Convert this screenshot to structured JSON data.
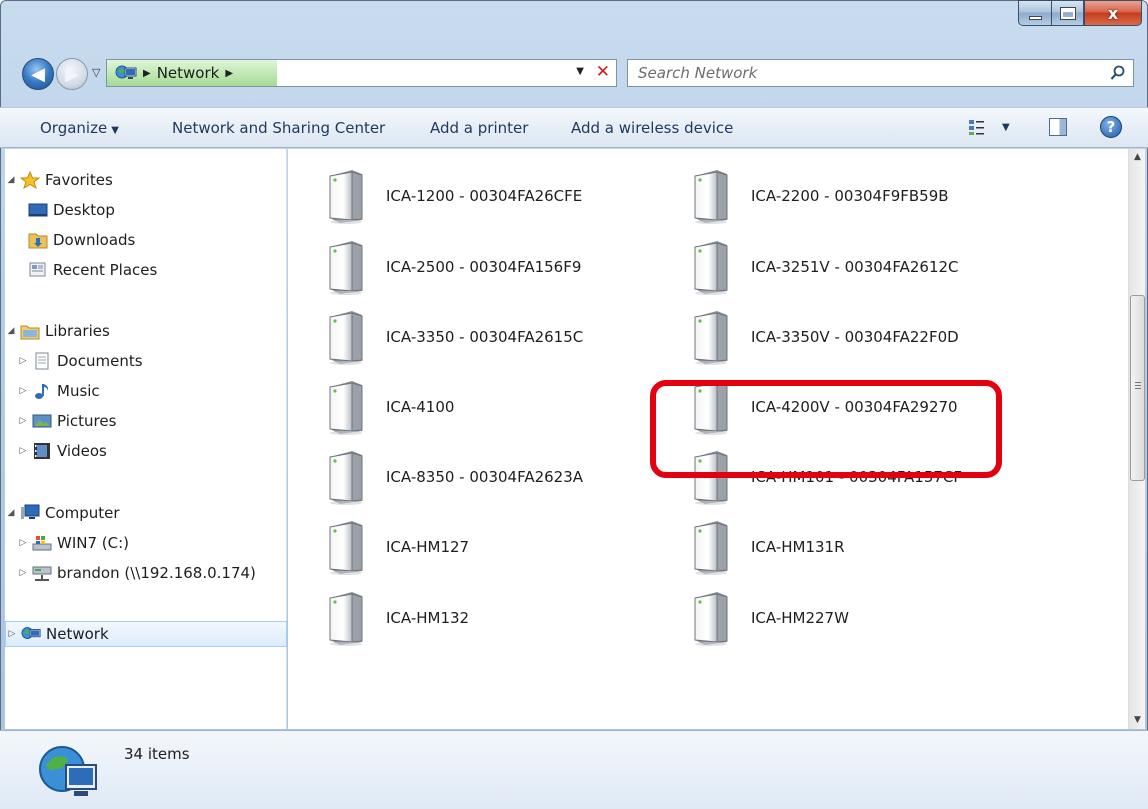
{
  "window": {
    "caption_close": "x"
  },
  "address_bar": {
    "location": "Network",
    "search_placeholder": "Search Network"
  },
  "toolbar": {
    "organize": "Organize",
    "network_sharing": "Network and Sharing Center",
    "add_printer": "Add a printer",
    "add_wireless": "Add a wireless device"
  },
  "nav": {
    "favorites": "Favorites",
    "desktop": "Desktop",
    "downloads": "Downloads",
    "recent_places": "Recent Places",
    "libraries": "Libraries",
    "documents": "Documents",
    "music": "Music",
    "pictures": "Pictures",
    "videos": "Videos",
    "computer": "Computer",
    "win7": "WIN7 (C:)",
    "brandon": "brandon (\\\\192.168.0.174)",
    "network": "Network"
  },
  "items": [
    "ICA-1200 - 00304FA26CFE",
    "ICA-2200 - 00304F9FB59B",
    "ICA-2500 - 00304FA156F9",
    "ICA-3251V - 00304FA2612C",
    "ICA-3350 - 00304FA2615C",
    "ICA-3350V - 00304FA22F0D",
    "ICA-4100",
    "ICA-4200V - 00304FA29270",
    "ICA-8350 - 00304FA2623A",
    "ICA-HM101 - 00304FA157CF",
    "ICA-HM127",
    "ICA-HM131R",
    "ICA-HM132",
    "ICA-HM227W"
  ],
  "highlighted_item": "ICA-4200V - 00304FA29270",
  "status": {
    "count": "34 items"
  },
  "colors": {
    "highlight": "#e3000f",
    "selection": "#dcecfc"
  }
}
